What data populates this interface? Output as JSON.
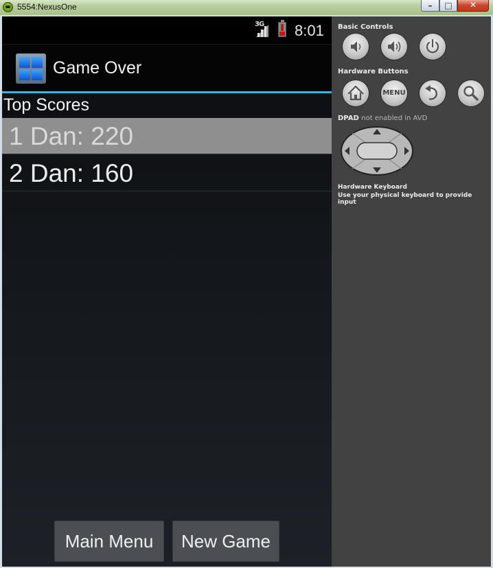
{
  "window": {
    "title": "5554:NexusOne",
    "minimize": "–",
    "maximize": "□",
    "close": "✕"
  },
  "statusbar": {
    "network": "3G",
    "time": "8:01"
  },
  "actionbar": {
    "title": "Game Over",
    "icon": "app-grid-icon"
  },
  "scores": {
    "header": "Top Scores",
    "items": [
      {
        "label": "1 Dan: 220",
        "selected": true
      },
      {
        "label": "2 Dan: 160",
        "selected": false
      }
    ]
  },
  "buttons": {
    "main_menu": "Main Menu",
    "new_game": "New Game"
  },
  "controls": {
    "basic_title": "Basic Controls",
    "hardware_title": "Hardware Buttons",
    "menu_label": "MENU",
    "dpad_title": "DPAD",
    "dpad_note": "not enabled in AVD",
    "keyboard_title": "Hardware Keyboard",
    "keyboard_note": "Use your physical keyboard to provide input"
  },
  "colors": {
    "accent": "#33b5e5",
    "selected_row": "#8f8f8f",
    "panel": "#424242"
  }
}
